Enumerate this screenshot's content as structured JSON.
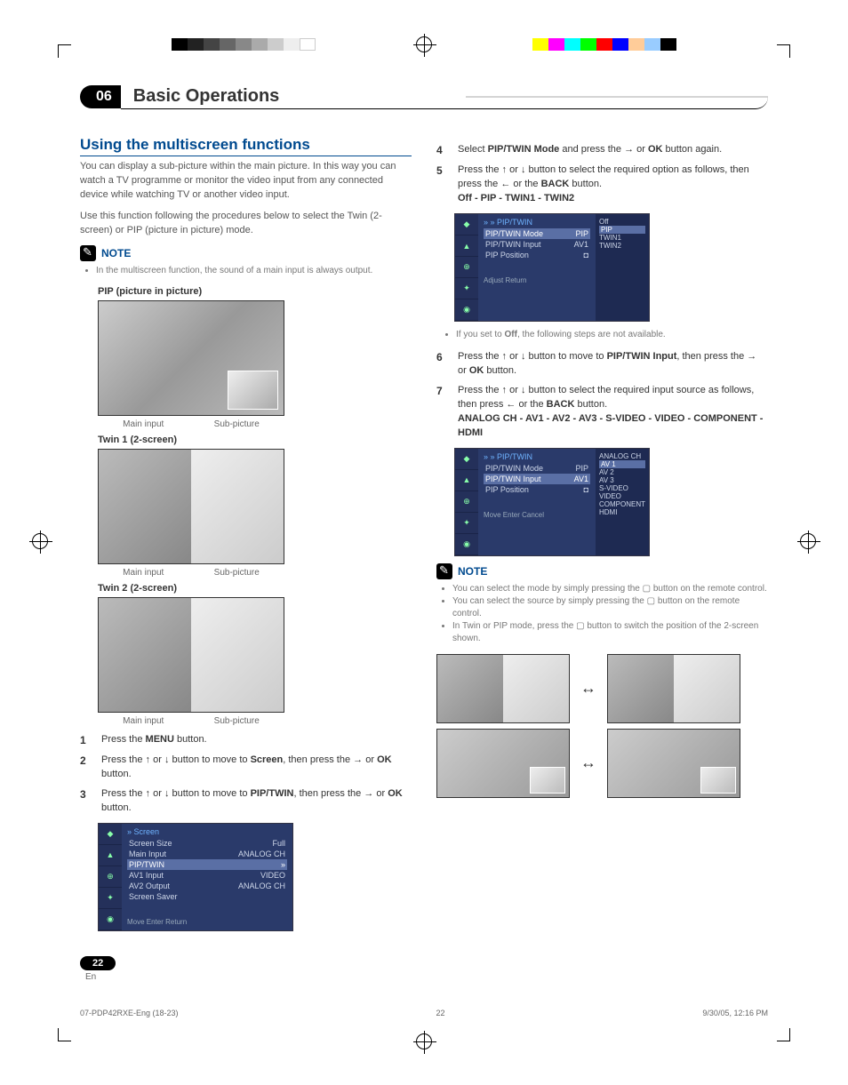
{
  "chapter": {
    "num": "06",
    "title": "Basic Operations"
  },
  "section": {
    "heading": "Using the multiscreen functions",
    "p1": "You can display a sub-picture within the main picture. In this way you can watch a TV programme or monitor the video input from any connected device while watching TV or another video input.",
    "p2": "Use this function following the procedures below to select the Twin (2-screen) or PIP (picture in picture) mode."
  },
  "note1": {
    "label": "NOTE",
    "bullet": "In the multiscreen function, the sound of a main input is always output."
  },
  "pip": {
    "title": "PIP (picture in picture)",
    "main": "Main input",
    "sub": "Sub-picture"
  },
  "twin1": {
    "title": "Twin 1 (2-screen)",
    "main": "Main input",
    "sub": "Sub-picture"
  },
  "twin2": {
    "title": "Twin 2 (2-screen)",
    "main": "Main input",
    "sub": "Sub-picture"
  },
  "steps_left": {
    "s1": "Press the MENU button.",
    "s2a": "Press the ",
    "s2b": " or ",
    "s2c": " button to move to ",
    "s2d": "Screen",
    "s2e": ", then press the ",
    "s2f": " or ",
    "s2g": "OK",
    "s2h": " button.",
    "s3a": "Press the ",
    "s3b": " or ",
    "s3c": " button to move to ",
    "s3d": "PIP/TWIN",
    "s3e": ", then press the ",
    "s3f": " or ",
    "s3g": "OK",
    "s3h": " button."
  },
  "osd1": {
    "title": "Screen",
    "rows": [
      {
        "l": "Screen Size",
        "r": "Full"
      },
      {
        "l": "Main Input",
        "r": "ANALOG CH"
      },
      {
        "l": "PIP/TWIN",
        "r": "»",
        "hl": true
      },
      {
        "l": "AV1 Input",
        "r": "VIDEO"
      },
      {
        "l": "AV2 Output",
        "r": "ANALOG CH"
      },
      {
        "l": "Screen Saver",
        "r": ""
      }
    ],
    "footer": "Move    Enter    Return"
  },
  "steps_right": {
    "s4a": "Select ",
    "s4b": "PIP/TWIN Mode",
    "s4c": " and press the ",
    "s4d": " or ",
    "s4e": "OK",
    "s4f": " button again.",
    "s5a": "Press the ",
    "s5b": " or ",
    "s5c": " button to select the required option as follows, then press the ",
    "s5d": " or the ",
    "s5e": "BACK",
    "s5f": " button.",
    "s5opts": "Off  - PIP - TWIN1 - TWIN2",
    "bullet_off": "If you set to Off, the following steps are not available.",
    "s6a": "Press the ",
    "s6b": " or ",
    "s6c": " button to move to ",
    "s6d": "PIP/TWIN Input",
    "s6e": ", then press the ",
    "s6f": " or ",
    "s6g": "OK",
    "s6h": " button.",
    "s7a": "Press the ",
    "s7b": " or ",
    "s7c": " button to select the required input source as follows, then press ",
    "s7d": " or the ",
    "s7e": "BACK",
    "s7f": " button.",
    "s7opts": "ANALOG CH - AV1 - AV2 - AV3 - S-VIDEO - VIDEO - COMPONENT - HDMI"
  },
  "osd2": {
    "title": "PIP/TWIN",
    "rows": [
      {
        "l": "PIP/TWIN Mode",
        "r": "PIP",
        "hl": true
      },
      {
        "l": "PIP/TWIN Input",
        "r": "AV1"
      },
      {
        "l": "PIP Position",
        "r": "◘"
      }
    ],
    "side": [
      "Off",
      "PIP",
      "TWIN1",
      "TWIN2"
    ],
    "sideSel": "PIP",
    "footer": "Adjust    Return"
  },
  "osd3": {
    "title": "PIP/TWIN",
    "rows": [
      {
        "l": "PIP/TWIN Mode",
        "r": "PIP"
      },
      {
        "l": "PIP/TWIN Input",
        "r": "AV1",
        "hl": true
      },
      {
        "l": "PIP Position",
        "r": "◘"
      }
    ],
    "side": [
      "ANALOG CH",
      "AV 1",
      "AV 2",
      "AV 3",
      "S-VIDEO",
      "VIDEO",
      "COMPONENT",
      "HDMI"
    ],
    "sideSel": "AV 1",
    "footer": "Move    Enter    Cancel"
  },
  "note2": {
    "label": "NOTE",
    "b1": "You can select the mode by simply pressing the ▢ button on the remote control.",
    "b2": "You can select the source by simply pressing the ▢ button on the remote control.",
    "b3": "In Twin or PIP mode, press the ▢ button to switch the position of the 2-screen shown."
  },
  "page": {
    "num": "22",
    "lang": "En"
  },
  "footer": {
    "file": "07-PDP42RXE-Eng (18-23)",
    "pg": "22",
    "date": "9/30/05, 12:16 PM"
  }
}
